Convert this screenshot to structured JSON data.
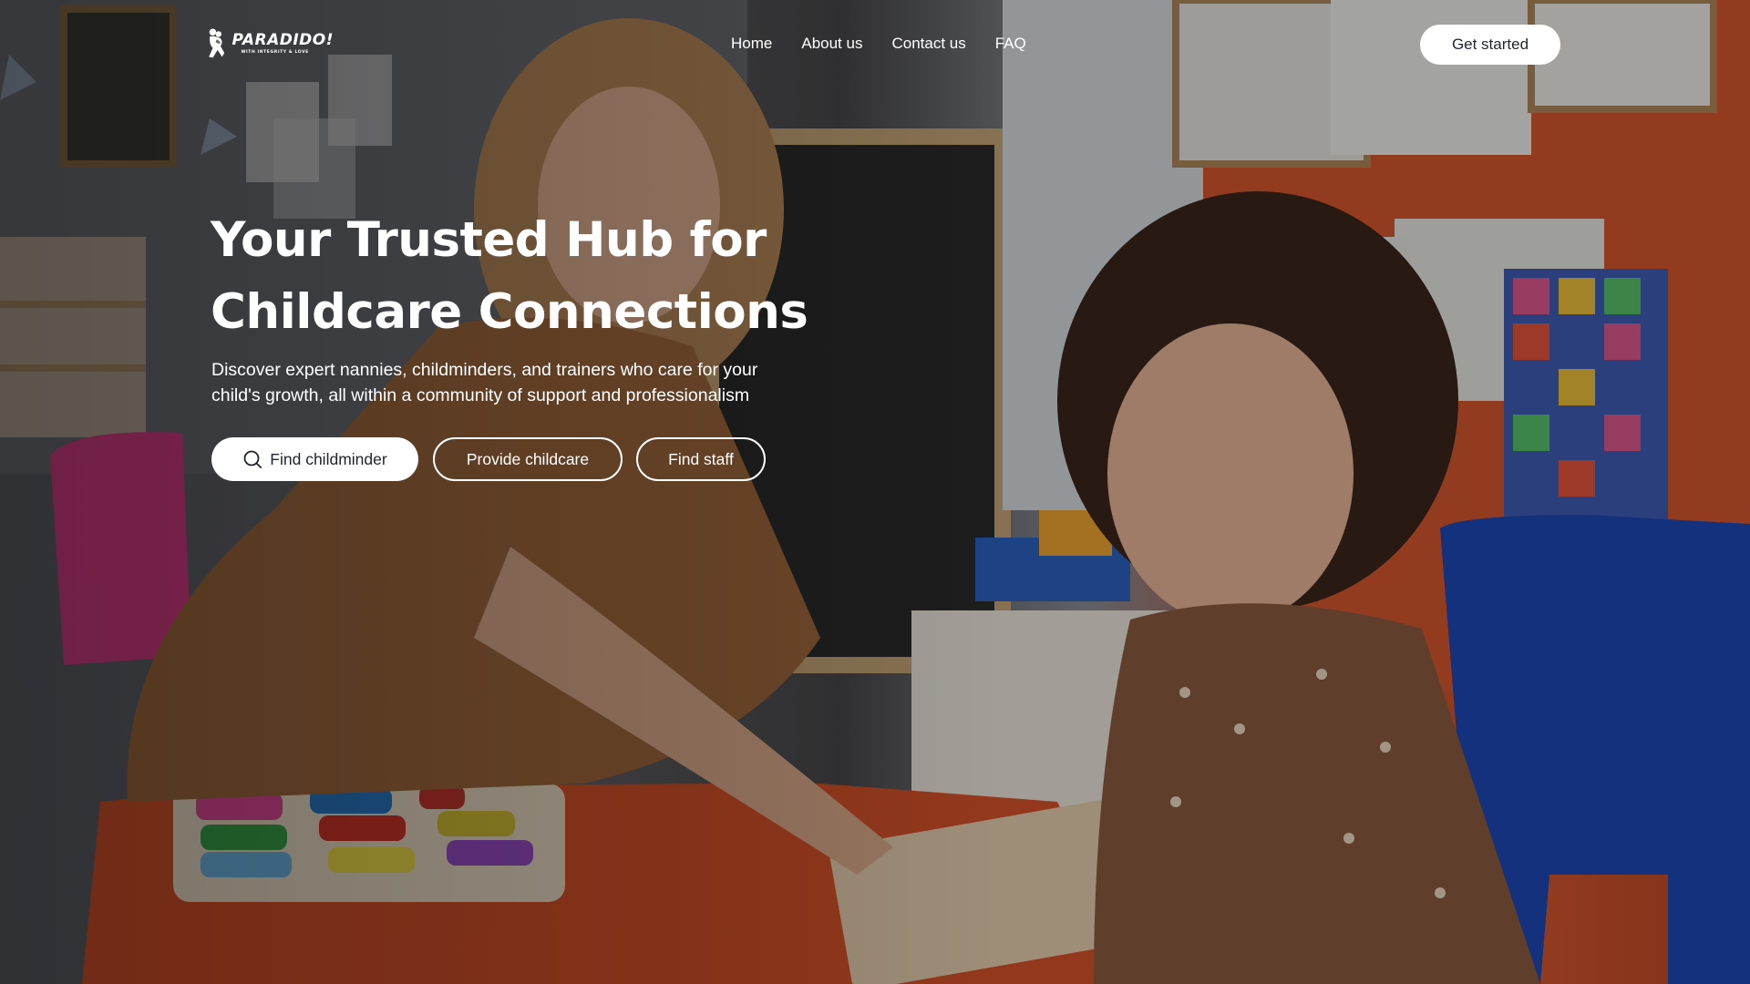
{
  "brand": {
    "name": "PARADIDO!",
    "tagline": "WITH INTEGRITY & LOVE",
    "logo_icon": "paradido-figures-logo"
  },
  "nav": {
    "links": [
      {
        "label": "Home"
      },
      {
        "label": "About us"
      },
      {
        "label": "Contact us"
      },
      {
        "label": "FAQ"
      }
    ],
    "cta_label": "Get started"
  },
  "hero": {
    "title_lines": [
      "Your Trusted Hub for",
      "Childcare Connections"
    ],
    "subtitle_lines": [
      "Discover expert nannies, childminders, and trainers who care for your",
      "child's growth, all within a community of support and professionalism"
    ],
    "buttons": {
      "find_childminder": {
        "label": "Find childminder",
        "icon": "search-icon"
      },
      "provide_childcare": {
        "label": "Provide childcare"
      },
      "find_staff": {
        "label": "Find staff"
      }
    },
    "background_image": "photo-woman-and-girl-playing-with-puzzle-in-classroom"
  },
  "colors": {
    "button_text": "#1f2430",
    "white": "#ffffff",
    "accent_orange": "#d9572e"
  }
}
